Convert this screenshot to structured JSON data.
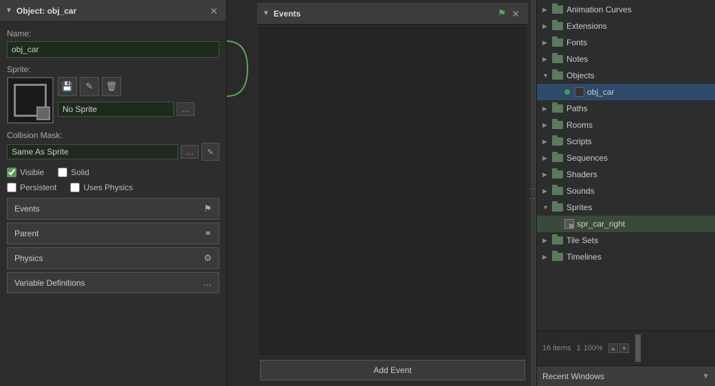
{
  "object_panel": {
    "title": "Object: obj_car",
    "name_label": "Name:",
    "name_value": "obj_car",
    "sprite_label": "Sprite:",
    "sprite_name": "No Sprite",
    "collision_mask_label": "Collision Mask:",
    "collision_mask_value": "Same As Sprite",
    "checkboxes": [
      {
        "id": "visible",
        "label": "Visible",
        "checked": true
      },
      {
        "id": "solid",
        "label": "Solid",
        "checked": false
      },
      {
        "id": "persistent",
        "label": "Persistent",
        "checked": false
      },
      {
        "id": "uses_physics",
        "label": "Uses Physics",
        "checked": false
      }
    ],
    "buttons": [
      {
        "id": "events",
        "label": "Events",
        "icon": "⚑"
      },
      {
        "id": "parent",
        "label": "Parent",
        "icon": "⚭"
      },
      {
        "id": "physics",
        "label": "Physics",
        "icon": "⚙"
      },
      {
        "id": "variable_definitions",
        "label": "Variable Definitions",
        "icon": "…"
      }
    ]
  },
  "events_panel": {
    "title": "Events",
    "add_event_label": "Add Event"
  },
  "asset_tree": {
    "items": [
      {
        "id": "animation_curves",
        "label": "Animation Curves",
        "indent": 0,
        "type": "folder",
        "expanded": false
      },
      {
        "id": "extensions",
        "label": "Extensions",
        "indent": 0,
        "type": "folder",
        "expanded": false
      },
      {
        "id": "fonts",
        "label": "Fonts",
        "indent": 0,
        "type": "folder",
        "expanded": false
      },
      {
        "id": "notes",
        "label": "Notes",
        "indent": 0,
        "type": "folder",
        "expanded": false
      },
      {
        "id": "objects",
        "label": "Objects",
        "indent": 0,
        "type": "folder",
        "expanded": true,
        "selected": false
      },
      {
        "id": "obj_car",
        "label": "obj_car",
        "indent": 1,
        "type": "object",
        "expanded": false,
        "selected": true
      },
      {
        "id": "paths",
        "label": "Paths",
        "indent": 0,
        "type": "folder",
        "expanded": false
      },
      {
        "id": "rooms",
        "label": "Rooms",
        "indent": 0,
        "type": "folder",
        "expanded": false
      },
      {
        "id": "scripts",
        "label": "Scripts",
        "indent": 0,
        "type": "folder",
        "expanded": false
      },
      {
        "id": "sequences",
        "label": "Sequences",
        "indent": 0,
        "type": "folder",
        "expanded": false
      },
      {
        "id": "shaders",
        "label": "Shaders",
        "indent": 0,
        "type": "folder",
        "expanded": false
      },
      {
        "id": "sounds",
        "label": "Sounds",
        "indent": 0,
        "type": "folder",
        "expanded": false
      },
      {
        "id": "sprites",
        "label": "Sprites",
        "indent": 0,
        "type": "folder",
        "expanded": true,
        "highlighted": false
      },
      {
        "id": "spr_car_right",
        "label": "spr_car_right",
        "indent": 1,
        "type": "sprite",
        "expanded": false,
        "highlighted": true
      },
      {
        "id": "tile_sets",
        "label": "Tile Sets",
        "indent": 0,
        "type": "folder",
        "expanded": false
      },
      {
        "id": "timelines",
        "label": "Timelines",
        "indent": 0,
        "type": "folder",
        "expanded": false
      }
    ],
    "status": {
      "count": "16 items",
      "separator": "",
      "zoom": "1",
      "zoom_label": "100%"
    },
    "recent_windows_label": "Recent Windows"
  }
}
